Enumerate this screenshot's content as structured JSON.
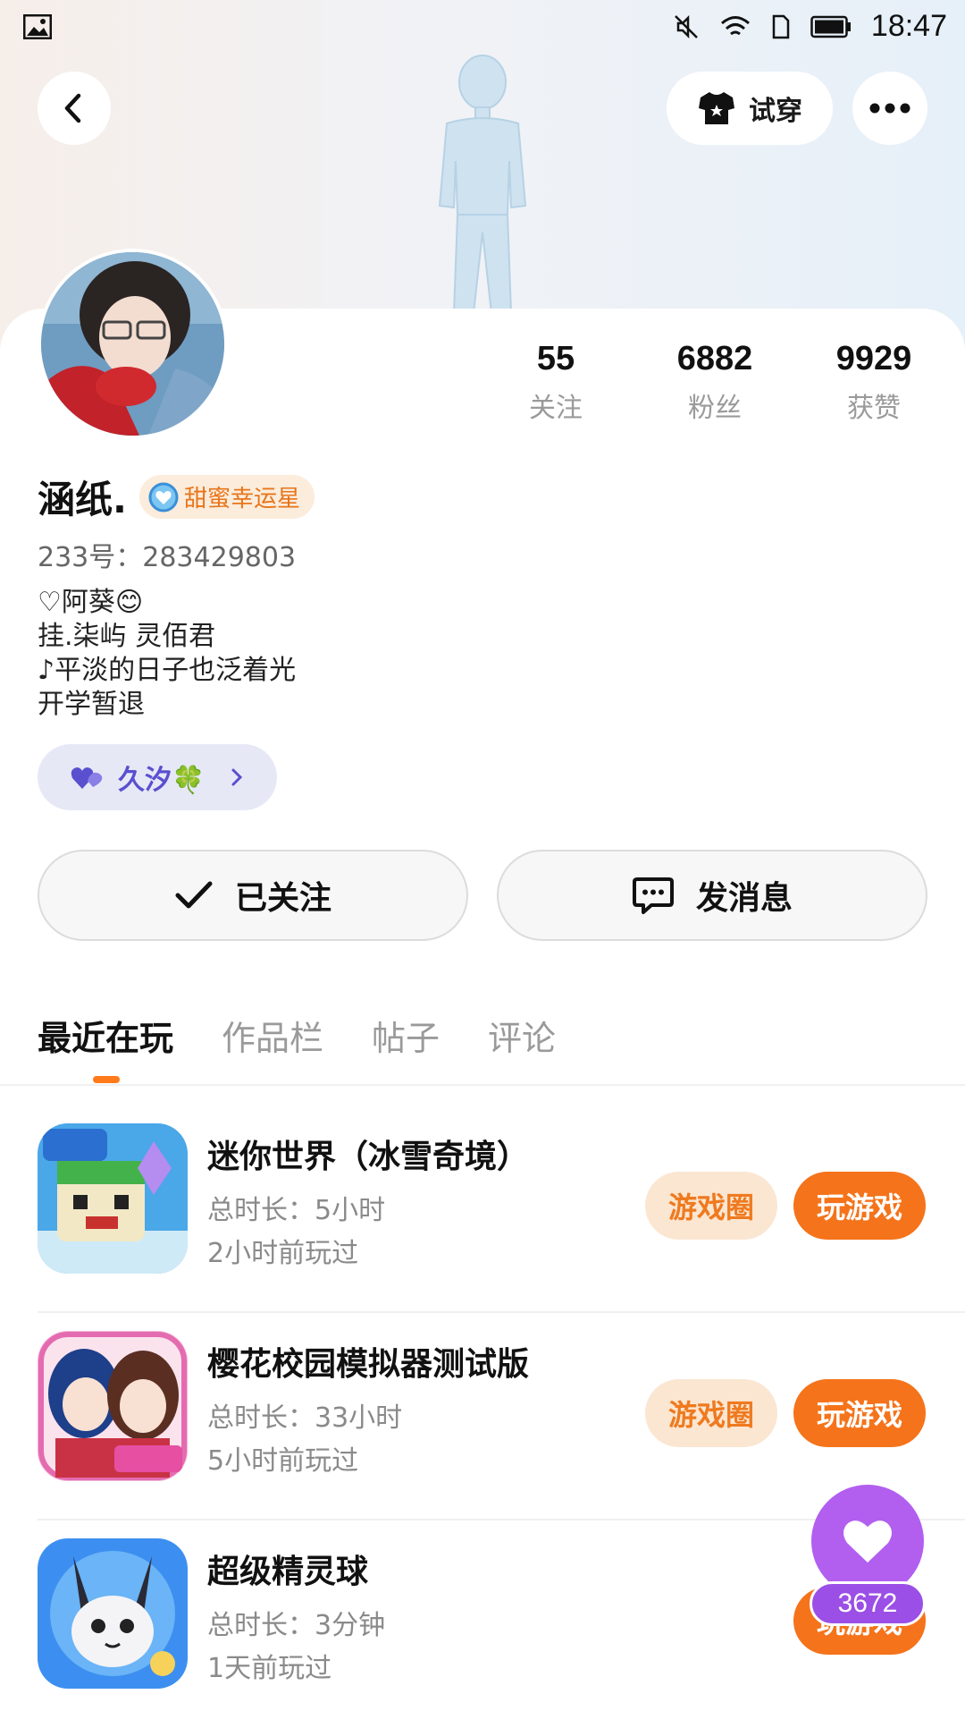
{
  "status_bar": {
    "time": "18:47"
  },
  "header": {
    "try_on_label": "试穿"
  },
  "stats": [
    {
      "value": "55",
      "label": "关注"
    },
    {
      "value": "6882",
      "label": "粉丝"
    },
    {
      "value": "9929",
      "label": "获赞"
    }
  ],
  "profile": {
    "name": "涵纸.",
    "badge": "甜蜜幸运星",
    "uid": "233号：283429803",
    "bio": [
      "♡阿葵😊",
      "挂.柒屿 灵佰君",
      "♪平淡的日子也泛着光",
      "开学暂退"
    ],
    "fan_group": "久汐🍀"
  },
  "actions": {
    "followed": "已关注",
    "message": "发消息"
  },
  "tabs": [
    "最近在玩",
    "作品栏",
    "帖子",
    "评论"
  ],
  "games": [
    {
      "title": "迷你世界（冰雪奇境）",
      "duration": "总时长：5小时",
      "last_played": "2小时前玩过",
      "circle": "游戏圈",
      "play": "玩游戏"
    },
    {
      "title": "樱花校园模拟器测试版",
      "duration": "总时长：33小时",
      "last_played": "5小时前玩过",
      "circle": "游戏圈",
      "play": "玩游戏"
    },
    {
      "title": "超级精灵球",
      "duration": "总时长：3分钟",
      "last_played": "1天前玩过",
      "circle": "",
      "play": "玩游戏"
    }
  ],
  "like": {
    "count": "3672"
  },
  "colors": {
    "accent": "#f5731a",
    "accent_light": "#fbe6d2",
    "purple": "#b25ff0"
  }
}
